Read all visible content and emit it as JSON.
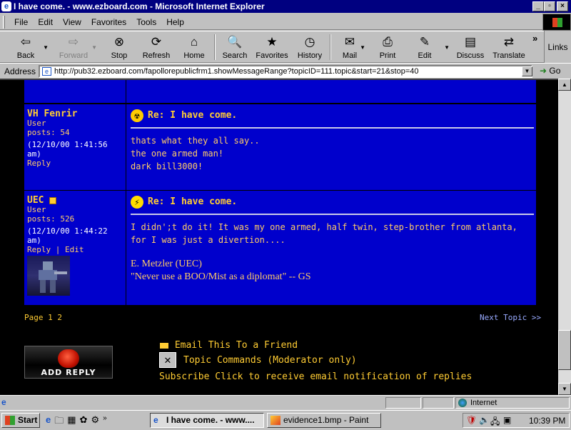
{
  "window": {
    "title": "I have come. - www.ezboard.com - Microsoft Internet Explorer",
    "minimize": "_",
    "maximize": "▫",
    "close": "×"
  },
  "menu": [
    "File",
    "Edit",
    "View",
    "Favorites",
    "Tools",
    "Help"
  ],
  "toolbar": {
    "back": "Back",
    "forward": "Forward",
    "stop": "Stop",
    "refresh": "Refresh",
    "home": "Home",
    "search": "Search",
    "favorites": "Favorites",
    "history": "History",
    "mail": "Mail",
    "print": "Print",
    "edit": "Edit",
    "discuss": "Discuss",
    "translate": "Translate",
    "more": "»",
    "links": "Links"
  },
  "address": {
    "label": "Address",
    "url": "http://pub32.ezboard.com/fapollorepublicfrm1.showMessageRange?topicID=111.topic&start=21&stop=40",
    "go": "Go"
  },
  "posts": [
    {
      "author": "VH Fenrir",
      "role": "User",
      "posts": "posts: 54",
      "date": "(12/10/00 1:41:56 am)",
      "actions": "Reply",
      "title": "Re: I have come.",
      "body": [
        "thats what they all say..",
        "the one armed man!",
        "dark bill3000!"
      ]
    },
    {
      "author": "UEC",
      "role": "User",
      "posts": "posts: 526",
      "date": "(12/10/00 1:44:22 am)",
      "actions": "Reply | Edit",
      "title": "Re: I have come.",
      "body": [
        "I didn';t do it! It was my one armed, half twin, step-brother from atlanta, for I was just a divertion...."
      ],
      "signature": [
        "E. Metzler (UEC)",
        "\"Never use a BOO/Mist as a diplomat\" -- GS"
      ]
    }
  ],
  "pagination": {
    "label": "Page",
    "pages": [
      "1",
      "2"
    ],
    "next": "Next Topic >>"
  },
  "actions": {
    "add_reply": "ADD REPLY",
    "email": "Email This To a Friend",
    "topic_commands": "Topic Commands (Moderator only)",
    "subscribe": "Subscribe Click to receive email notification of replies"
  },
  "status": {
    "zone": "Internet"
  },
  "taskbar": {
    "start": "Start",
    "tasks": [
      "I have come. - www....",
      "evidence1.bmp - Paint"
    ],
    "clock": "10:39 PM"
  },
  "colors": {
    "post_bg": "#0000cc",
    "accent_text": "#ffcc33",
    "titlebar": "#000080"
  }
}
